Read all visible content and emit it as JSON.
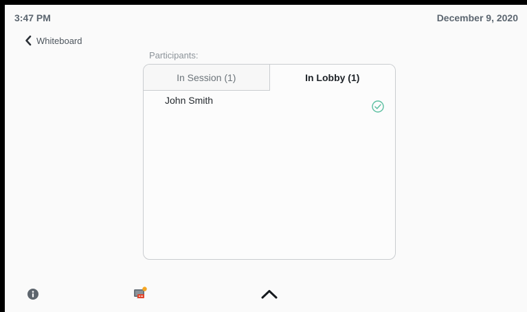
{
  "status_bar": {
    "time": "3:47 PM",
    "date": "December 9, 2020"
  },
  "nav": {
    "back_label": "Whiteboard",
    "back_icon": "chevron-left-icon"
  },
  "participants": {
    "label": "Participants:",
    "tabs": [
      {
        "label": "In Session (1)",
        "active": false
      },
      {
        "label": "In Lobby (1)",
        "active": true
      }
    ],
    "lobby_list": [
      {
        "name": "John Smith",
        "action_icon": "check-circle-icon"
      }
    ]
  },
  "bottom_bar": {
    "icons": [
      "info-icon",
      "content-share-icon",
      "chevron-up-icon"
    ]
  },
  "colors": {
    "accent_check": "#5bbfa0",
    "badge": "#f5a623",
    "share_red": "#e2452b"
  }
}
